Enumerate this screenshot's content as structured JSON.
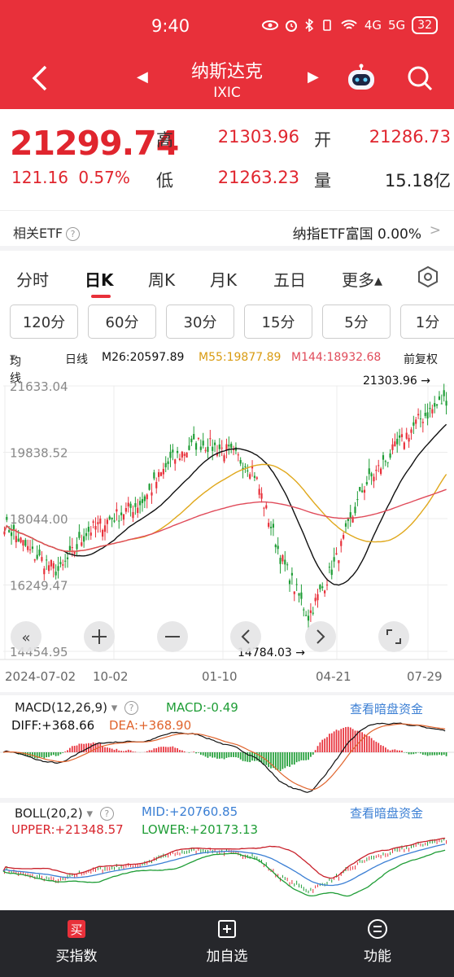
{
  "status_bar": {
    "time": "9:40",
    "network": "4G",
    "network2": "5G",
    "battery": "32"
  },
  "header": {
    "title": "纳斯达克",
    "subtitle": "IXIC"
  },
  "quote": {
    "price": "21299.74",
    "change": "121.16",
    "change_pct": "0.57%",
    "high_label": "高",
    "high": "21303.96",
    "low_label": "低",
    "low": "21263.23",
    "open_label": "开",
    "open": "21286.73",
    "volume_label": "量",
    "volume": "15.18亿"
  },
  "etf": {
    "label": "相关ETF",
    "help": "?",
    "name": "纳指ETF富国",
    "value": "0.00%",
    "chevron": ">"
  },
  "tabs": [
    {
      "label": "分时"
    },
    {
      "label": "日K"
    },
    {
      "label": "周K"
    },
    {
      "label": "月K"
    },
    {
      "label": "五日"
    },
    {
      "label": "更多▴"
    }
  ],
  "intervals": [
    {
      "label": "120分"
    },
    {
      "label": "60分"
    },
    {
      "label": "30分"
    },
    {
      "label": "15分"
    },
    {
      "label": "5分"
    },
    {
      "label": "1分"
    }
  ],
  "ma_legend": {
    "type": "均线",
    "dropdown": "▾",
    "line": "日线",
    "m26": "M26:20597.89",
    "m55": "M55:19877.89",
    "m144": "M144:18932.68",
    "adjust": "前复权"
  },
  "colors": {
    "red": "#e8303a",
    "green": "#1f9d36",
    "m26": "#111111",
    "m55": "#e0a81c",
    "m144": "#e04b5a",
    "blue": "#3b7fd4"
  },
  "chart_data": [
    {
      "type": "candlestick",
      "title": "",
      "y_tick_labels": [
        "21633.04",
        "19838.52",
        "18044.00",
        "16249.47",
        "14454.95"
      ],
      "ylim": [
        14454.95,
        21633.04
      ],
      "x_tick_labels": [
        "2024-07-02",
        "10-02",
        "01-10",
        "04-21",
        "07-29"
      ],
      "annotations": [
        {
          "text": "21303.96",
          "note": "max"
        },
        {
          "text": "14784.03",
          "note": "min"
        }
      ],
      "series": [
        {
          "name": "M26",
          "last": 20597.89
        },
        {
          "name": "M55",
          "last": 19877.89
        },
        {
          "name": "M144",
          "last": 18932.68
        }
      ],
      "close_trend": [
        17900,
        17100,
        16600,
        17700,
        18100,
        18500,
        19600,
        20100,
        19900,
        19400,
        17000,
        15400,
        16900,
        18900,
        19800,
        20700,
        21300
      ]
    },
    {
      "type": "bar",
      "title": "MACD(12,26,9)",
      "series": [
        {
          "name": "MACD",
          "last": -0.49
        },
        {
          "name": "DIFF",
          "last": 368.66
        },
        {
          "name": "DEA",
          "last": 368.9
        }
      ]
    },
    {
      "type": "line",
      "title": "BOLL(20,2)",
      "series": [
        {
          "name": "MID",
          "last": 20760.85
        },
        {
          "name": "UPPER",
          "last": 21348.57
        },
        {
          "name": "LOWER",
          "last": 20173.13
        }
      ]
    }
  ],
  "macd": {
    "title": "MACD(12,26,9)",
    "dropdown": "▾",
    "help": "?",
    "macd": "MACD:-0.49",
    "diff": "DIFF:+368.66",
    "dea": "DEA:+368.90",
    "link": "查看暗盘资金"
  },
  "boll": {
    "title": "BOLL(20,2)",
    "dropdown": "▾",
    "help": "?",
    "mid": "MID:+20760.85",
    "upper": "UPPER:+21348.57",
    "lower": "LOWER:+20173.13",
    "link": "查看暗盘资金"
  },
  "bottom_nav": [
    {
      "label": "买指数",
      "icon": "buy-icon",
      "glyph": "买"
    },
    {
      "label": "加自选",
      "icon": "add-icon"
    },
    {
      "label": "功能",
      "icon": "menu-icon"
    }
  ]
}
